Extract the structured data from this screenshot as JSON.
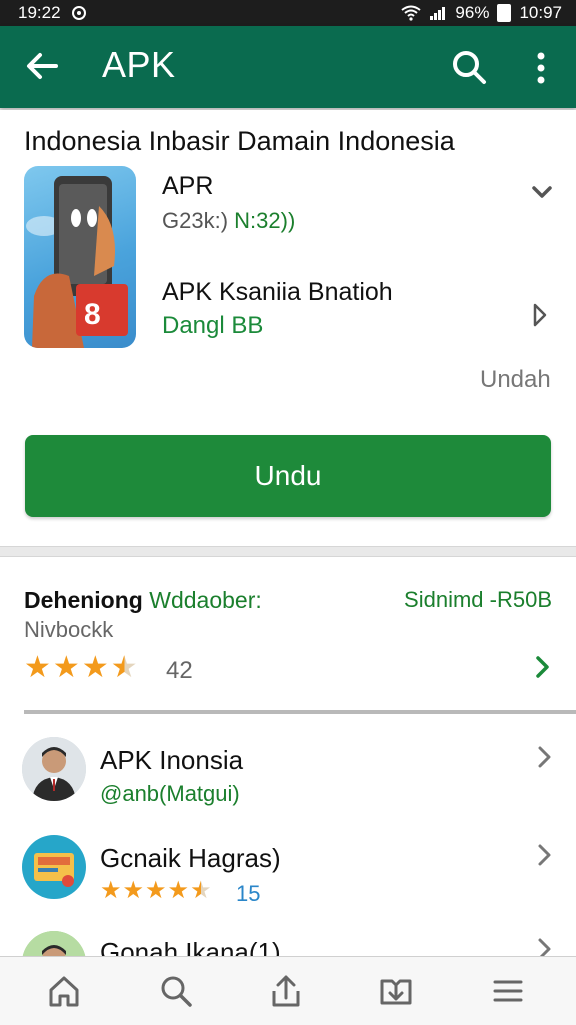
{
  "status_bar": {
    "time_left": "19:22",
    "battery_percent": "96%",
    "time_right": "10:97"
  },
  "app_bar": {
    "title": "APK",
    "back_icon": "arrow-left-icon",
    "search_icon": "search-icon",
    "more_icon": "more-vertical-icon",
    "color": "#0a6b4f"
  },
  "app_card": {
    "headline": "Indonesia Inbasir Damain Indonesia",
    "app_name": "APR",
    "size_prefix": "G23k:)",
    "size_suffix": "N:32))",
    "developer": "APK Ksaniia Bnatioh",
    "category": "Dangl BB",
    "side_label": "Undah",
    "install_label": "Undu",
    "install_color": "#1e8a3a"
  },
  "ratings": {
    "title_bold": "Deheniong",
    "title_green": "Wddaober:",
    "right_label": "Sidnimd -R50B",
    "subtitle": "Nivbockk",
    "rating": 3.5,
    "count": "42"
  },
  "list": [
    {
      "title": "APK Inonsia",
      "subtitle": "@anb(Matgui)"
    },
    {
      "title": "Gcnaik Hagras)",
      "rating": 4.5,
      "count": "15"
    },
    {
      "title": "Gonah Ikana(1)"
    }
  ],
  "bottom_nav": [
    "home-icon",
    "search-icon",
    "upload-icon",
    "library-icon",
    "menu-icon"
  ]
}
